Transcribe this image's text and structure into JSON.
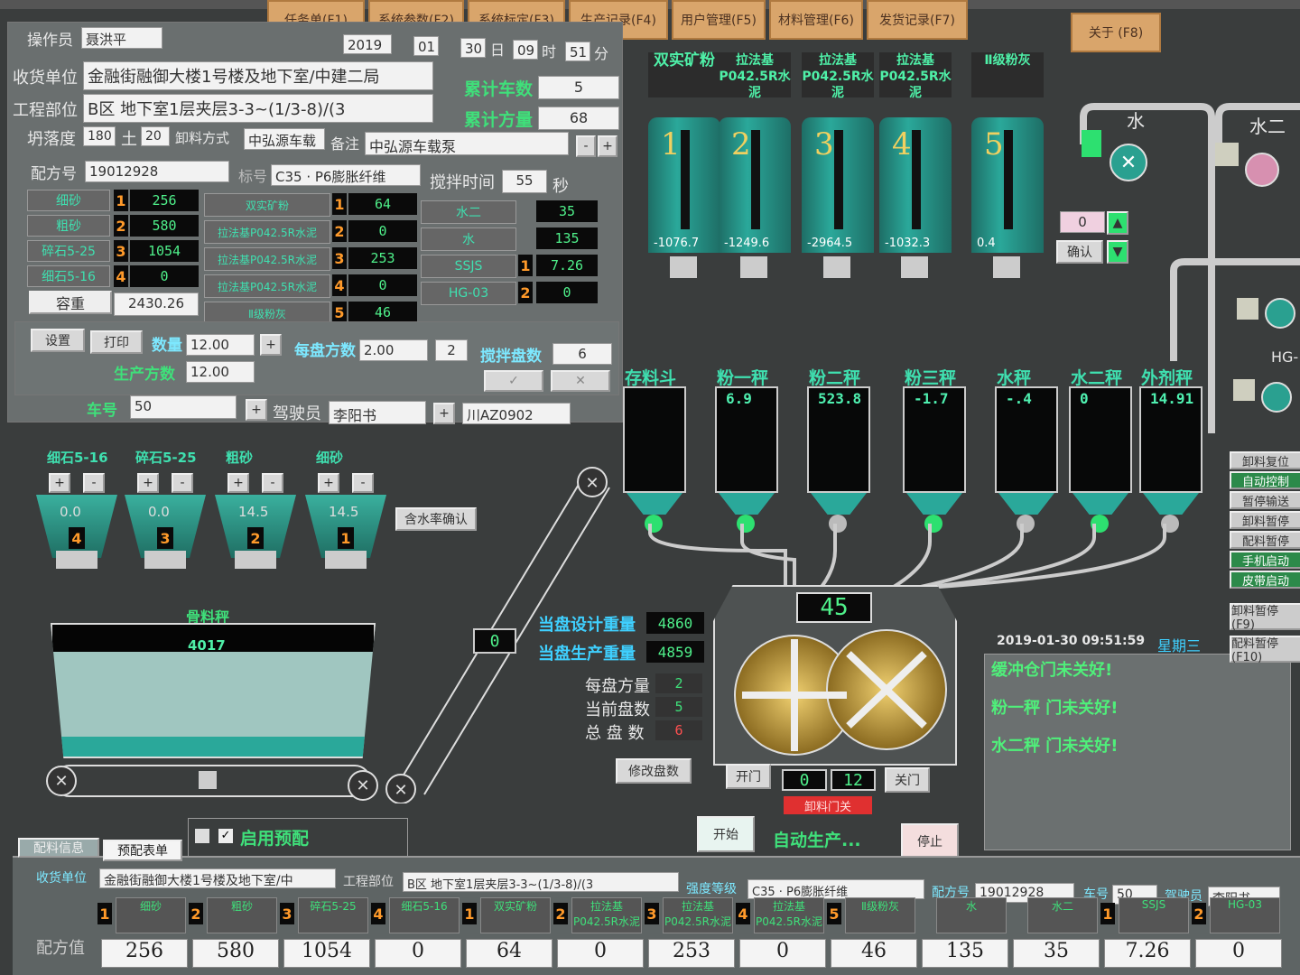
{
  "tabs": [
    "任务单(F1)",
    "系统参数(F2)",
    "系统标定(F3)",
    "生产记录(F4)",
    "用户管理(F5)",
    "材料管理(F6)",
    "发货记录(F7)",
    "关于 (F8)"
  ],
  "operator": {
    "label": "操作员",
    "value": "聂洪平"
  },
  "date": {
    "year": "2019",
    "month": "01",
    "day": "30",
    "day_label": "日",
    "hour": "09",
    "hour_label": "时",
    "minute": "51",
    "minute_label": "分"
  },
  "receiver": {
    "label": "收货单位",
    "value": "金融街融御大楼1号楼及地下室/中建二局"
  },
  "project": {
    "label": "工程部位",
    "value": "B区 地下室1层夹层3-3~(1/3-8)/(3"
  },
  "slump": {
    "label": "坍落度",
    "value": "180",
    "pm_label": "土",
    "pm": "20",
    "unload_label": "卸料方式",
    "unload": "中弘源车载",
    "remark_label": "备注",
    "remark": "中弘源车载泵"
  },
  "totals": {
    "cars_label": "累计车数",
    "cars": "5",
    "volume_label": "累计方量",
    "volume": "68"
  },
  "recipe": {
    "label": "配方号",
    "value": "19012928",
    "grade_label": "标号",
    "grade": "C35 · P6膨胀纤维",
    "mix_label": "搅拌时间",
    "mix": "55",
    "mix_unit": "秒"
  },
  "aggregates": [
    {
      "name": "细砂",
      "idx": "1",
      "val": "256"
    },
    {
      "name": "粗砂",
      "idx": "2",
      "val": "580"
    },
    {
      "name": "碎石5-25",
      "idx": "3",
      "val": "1054"
    },
    {
      "name": "细石5-16",
      "idx": "4",
      "val": "0"
    }
  ],
  "powders": [
    {
      "name": "双实矿粉",
      "idx": "1",
      "val": "64"
    },
    {
      "name": "拉法基P042.5R水泥",
      "idx": "2",
      "val": "0"
    },
    {
      "name": "拉法基P042.5R水泥",
      "idx": "3",
      "val": "253"
    },
    {
      "name": "拉法基P042.5R水泥",
      "idx": "4",
      "val": "0"
    },
    {
      "name": "Ⅱ级粉灰",
      "idx": "5",
      "val": "46"
    }
  ],
  "liquids": [
    {
      "name": "水二",
      "idx": "",
      "val": "35"
    },
    {
      "name": "水",
      "idx": "",
      "val": "135"
    },
    {
      "name": "SSJS",
      "idx": "1",
      "val": "7.26"
    },
    {
      "name": "HG-03",
      "idx": "2",
      "val": "0"
    }
  ],
  "density": {
    "label": "容重",
    "value": "2430.26"
  },
  "controls": {
    "set": "设置",
    "print": "打印",
    "qty_label": "数量",
    "qty": "12.00",
    "per_label": "每盘方数",
    "per": "2.00",
    "per_n": "2",
    "mix_count_label": "搅拌盘数",
    "mix_count": "6",
    "produced_label": "生产方数",
    "produced": "12.00",
    "car_label": "车号",
    "car": "50",
    "driver_label": "驾驶员",
    "driver": "李阳书",
    "plate": "川AZ0902"
  },
  "silos": [
    {
      "name": "双实矿粉",
      "num": "1",
      "val": "-1076.7"
    },
    {
      "name": "拉法基P042.5R水泥",
      "num": "2",
      "val": "-1249.6"
    },
    {
      "name": "拉法基P042.5R水泥",
      "num": "3",
      "val": "-2964.5"
    },
    {
      "name": "拉法基P042.5R水泥",
      "num": "4",
      "val": "-1032.3"
    },
    {
      "name": "Ⅱ级粉灰",
      "num": "5",
      "val": "0.4"
    }
  ],
  "water": {
    "w1": "水",
    "w2": "水二",
    "input": "0",
    "confirm": "确认",
    "hg": "HG-"
  },
  "scales": [
    {
      "name": "存料斗",
      "val": ""
    },
    {
      "name": "粉一秤",
      "val": "6.9"
    },
    {
      "name": "粉二秤",
      "val": "523.8"
    },
    {
      "name": "粉三秤",
      "val": "-1.7"
    },
    {
      "name": "水秤",
      "val": "-.4"
    },
    {
      "name": "水二秤",
      "val": "0"
    },
    {
      "name": "外剂秤",
      "val": "14.91"
    }
  ],
  "agg_hoppers": [
    {
      "name": "细石5-16",
      "val": "0.0",
      "num": "4"
    },
    {
      "name": "碎石5-25",
      "val": "0.0",
      "num": "3"
    },
    {
      "name": "粗砂",
      "val": "14.5",
      "num": "2"
    },
    {
      "name": "细砂",
      "val": "14.5",
      "num": "1"
    }
  ],
  "agg_confirm": "含水率确认",
  "bone_scale": {
    "name": "骨料秤",
    "val": "4017"
  },
  "conveyor_val": "0",
  "mixer": {
    "count": "45",
    "design_label": "当盘设计重量",
    "design": "4860",
    "prod_label": "当盘生产重量",
    "prod": "4859",
    "per_label": "每盘方量",
    "per": "2",
    "cur_label": "当前盘数",
    "cur": "5",
    "total_label": "总 盘 数",
    "total": "6",
    "modify": "修改盘数",
    "open": "开门",
    "close": "关门",
    "door_a": "0",
    "door_b": "12",
    "alarm": "卸料门关",
    "start": "开始",
    "auto": "自动生产...",
    "stop": "停止"
  },
  "log": {
    "time": "2019-01-30 09:51:59",
    "weekday": "星期三",
    "lines": [
      "缓冲仓门未关好!",
      "粉一秤 门未关好!",
      "水二秤 门未关好!"
    ]
  },
  "side_buttons": [
    "卸料复位",
    "自动控制",
    "暂停输送",
    "卸料暂停",
    "配料暂停",
    "手机启动",
    "皮带启动",
    "卸料暂停(F9)",
    "配料暂停(F10)"
  ],
  "preset": {
    "check_label": "启用预配",
    "tab1": "配料信息",
    "tab2": "预配表单"
  },
  "bottom": {
    "receiver_label": "收货单位",
    "receiver": "金融街融御大楼1号楼及地下室/中",
    "project_label": "工程部位",
    "project": "B区 地下室1层夹层3-3~(1/3-8)/(3",
    "grade_label": "强度等级",
    "grade": "C35 · P6膨胀纤维",
    "recipe_label": "配方号",
    "recipe": "19012928",
    "car_label": "车号",
    "car": "50",
    "driver_label": "驾驶员",
    "driver": "李阳书",
    "row_label": "配方值",
    "cols": [
      {
        "idx": "1",
        "name": "细砂",
        "val": "256"
      },
      {
        "idx": "2",
        "name": "粗砂",
        "val": "580"
      },
      {
        "idx": "3",
        "name": "碎石5-25",
        "val": "1054"
      },
      {
        "idx": "4",
        "name": "细石5-16",
        "val": "0"
      },
      {
        "idx": "1",
        "name": "双实矿粉",
        "val": "64"
      },
      {
        "idx": "2",
        "name": "拉法基P042.5R水泥",
        "val": "0"
      },
      {
        "idx": "3",
        "name": "拉法基P042.5R水泥",
        "val": "253"
      },
      {
        "idx": "4",
        "name": "拉法基P042.5R水泥",
        "val": "0"
      },
      {
        "idx": "5",
        "name": "Ⅱ级粉灰",
        "val": "46"
      },
      {
        "idx": "",
        "name": "水",
        "val": "135"
      },
      {
        "idx": "",
        "name": "水二",
        "val": "35"
      },
      {
        "idx": "1",
        "name": "SSJS",
        "val": "7.26"
      },
      {
        "idx": "2",
        "name": "HG-03",
        "val": "0"
      }
    ]
  }
}
